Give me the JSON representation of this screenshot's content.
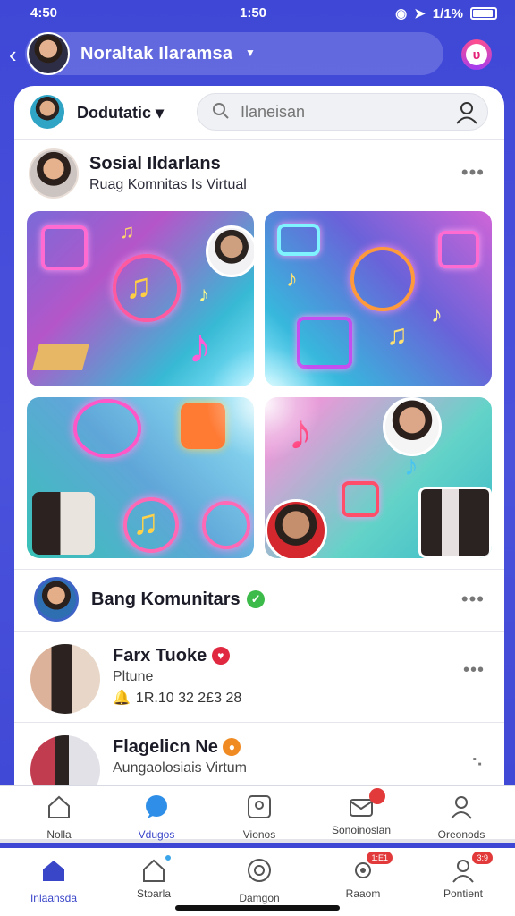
{
  "status_bar": {
    "time_left": "4:50",
    "time_center": "1:50",
    "signal_text": "1/1%"
  },
  "top_bar": {
    "profile_name": "Noraltak Ilaramsa"
  },
  "card_header": {
    "workspace_name": "Dodutatic",
    "search_placeholder": "Ilaneisan"
  },
  "post": {
    "title": "Sosial Ildarlans",
    "subtitle": "Ruag Komnitas Is Virtual",
    "menu": "•••"
  },
  "section": {
    "title": "Bang Komunitars",
    "menu": "•••"
  },
  "list": [
    {
      "title": "Farx Tuoke",
      "subtitle": "Pltune",
      "meta": "1R.10 32 2£3 28",
      "menu": "•••"
    },
    {
      "title": "Flagelicn Ne",
      "subtitle": "Aungaolosiais Virtum",
      "menu": "⠢"
    }
  ],
  "nav_top": [
    {
      "label": "Nolla",
      "icon": "home-icon"
    },
    {
      "label": "Vdugos",
      "icon": "chat-bubble-icon"
    },
    {
      "label": "Vionos",
      "icon": "profile-card-icon"
    },
    {
      "label": "Sonoinoslan",
      "icon": "mail-icon",
      "badge": ""
    },
    {
      "label": "Oreonods",
      "icon": "person-icon"
    }
  ],
  "nav_bottom": [
    {
      "label": "Inlaansda",
      "icon": "home-icon"
    },
    {
      "label": "Stoarla",
      "icon": "home-outline-icon"
    },
    {
      "label": "Damgon",
      "icon": "badge-icon"
    },
    {
      "label": "Raaom",
      "icon": "gear-icon",
      "badge": "1:E1"
    },
    {
      "label": "Pontient",
      "icon": "person-icon",
      "badge": "3:9"
    }
  ],
  "colors": {
    "brand": "#3f47d6",
    "active_nav": "#3a46c8",
    "badge_red": "#e23a3a",
    "verified_green": "#3cba4a"
  }
}
